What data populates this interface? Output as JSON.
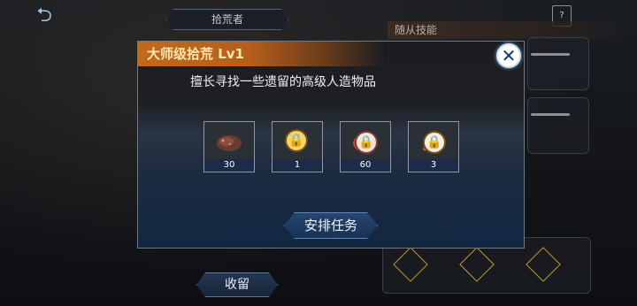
{
  "background": {
    "title": "拾荒者",
    "skill_header": "随从技能",
    "recall_label": "收留"
  },
  "dialog": {
    "title": "大师级拾荒 Lv1",
    "description": "擅长寻找一些遗留的高级人造物品",
    "items": [
      {
        "icon": "ore-icon",
        "count": "30",
        "locked": false
      },
      {
        "icon": "lock-icon",
        "count": "1",
        "locked": true
      },
      {
        "icon": "meat-lock-icon",
        "count": "60",
        "locked": true
      },
      {
        "icon": "fire-lock-icon",
        "count": "3",
        "locked": true
      }
    ],
    "assign_label": "安排任务"
  },
  "colors": {
    "header_orange": "#c06a1c",
    "accent_gold": "#c69a2e",
    "button_blue": "#27466e"
  }
}
